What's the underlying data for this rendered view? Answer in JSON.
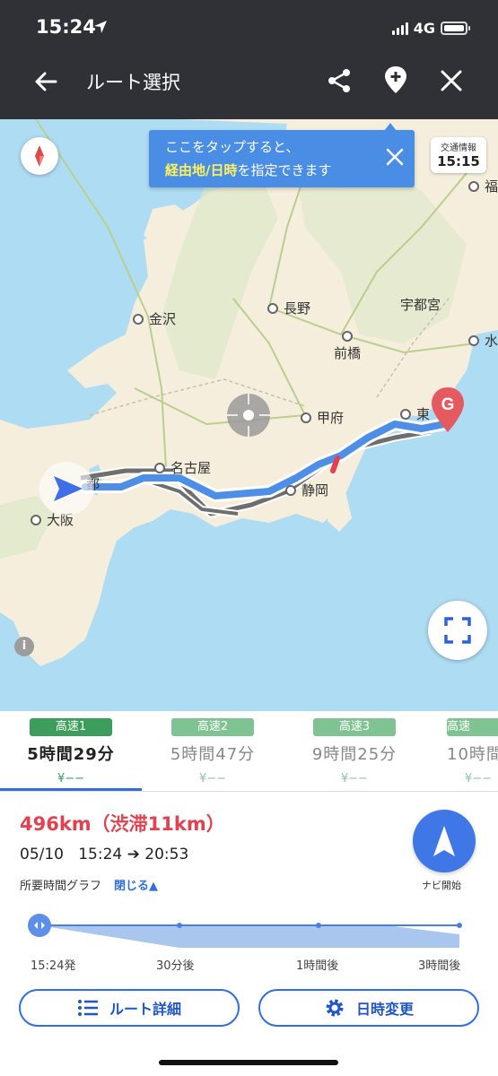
{
  "status": {
    "time": "15:24",
    "network": "4G"
  },
  "header": {
    "title": "ルート選択"
  },
  "tooltip": {
    "line1": "ここをタップすると、",
    "line2_highlight": "経由地/日時",
    "line2_rest": "を指定できます"
  },
  "traffic": {
    "label": "交通情報",
    "time": "15:15"
  },
  "map": {
    "cities": [
      "金沢",
      "長野",
      "宇都宮",
      "前橋",
      "甲府",
      "名古屋",
      "静岡",
      "大阪",
      "都",
      "東",
      "福",
      "水"
    ],
    "goal_label": "G",
    "info": "i"
  },
  "route_tabs": [
    {
      "badge": "高速1",
      "time": "5時間29分",
      "fee": "¥−−",
      "active": true,
      "color": "#3c9e5a"
    },
    {
      "badge": "高速2",
      "time": "5時間47分",
      "fee": "¥−−",
      "active": false,
      "color": "#7fc392"
    },
    {
      "badge": "高速3",
      "time": "9時間25分",
      "fee": "¥−−",
      "active": false,
      "color": "#7fc392"
    },
    {
      "badge": "高速",
      "time": "10時間",
      "fee": "¥−−",
      "active": false,
      "color": "#7fc392"
    }
  ],
  "detail": {
    "distance": "496km（渋滞11km）",
    "date": "05/10",
    "depart": "15:24",
    "arrow": "➔",
    "arrive": "20:53",
    "graph_label": "所要時間グラフ",
    "close_label": "閉じる▲",
    "navi_label": "ナビ開始",
    "ticks": [
      "15:24発",
      "30分後",
      "1時間後",
      "3時間後"
    ],
    "route_detail_btn": "ルート詳細",
    "datetime_btn": "日時変更"
  }
}
